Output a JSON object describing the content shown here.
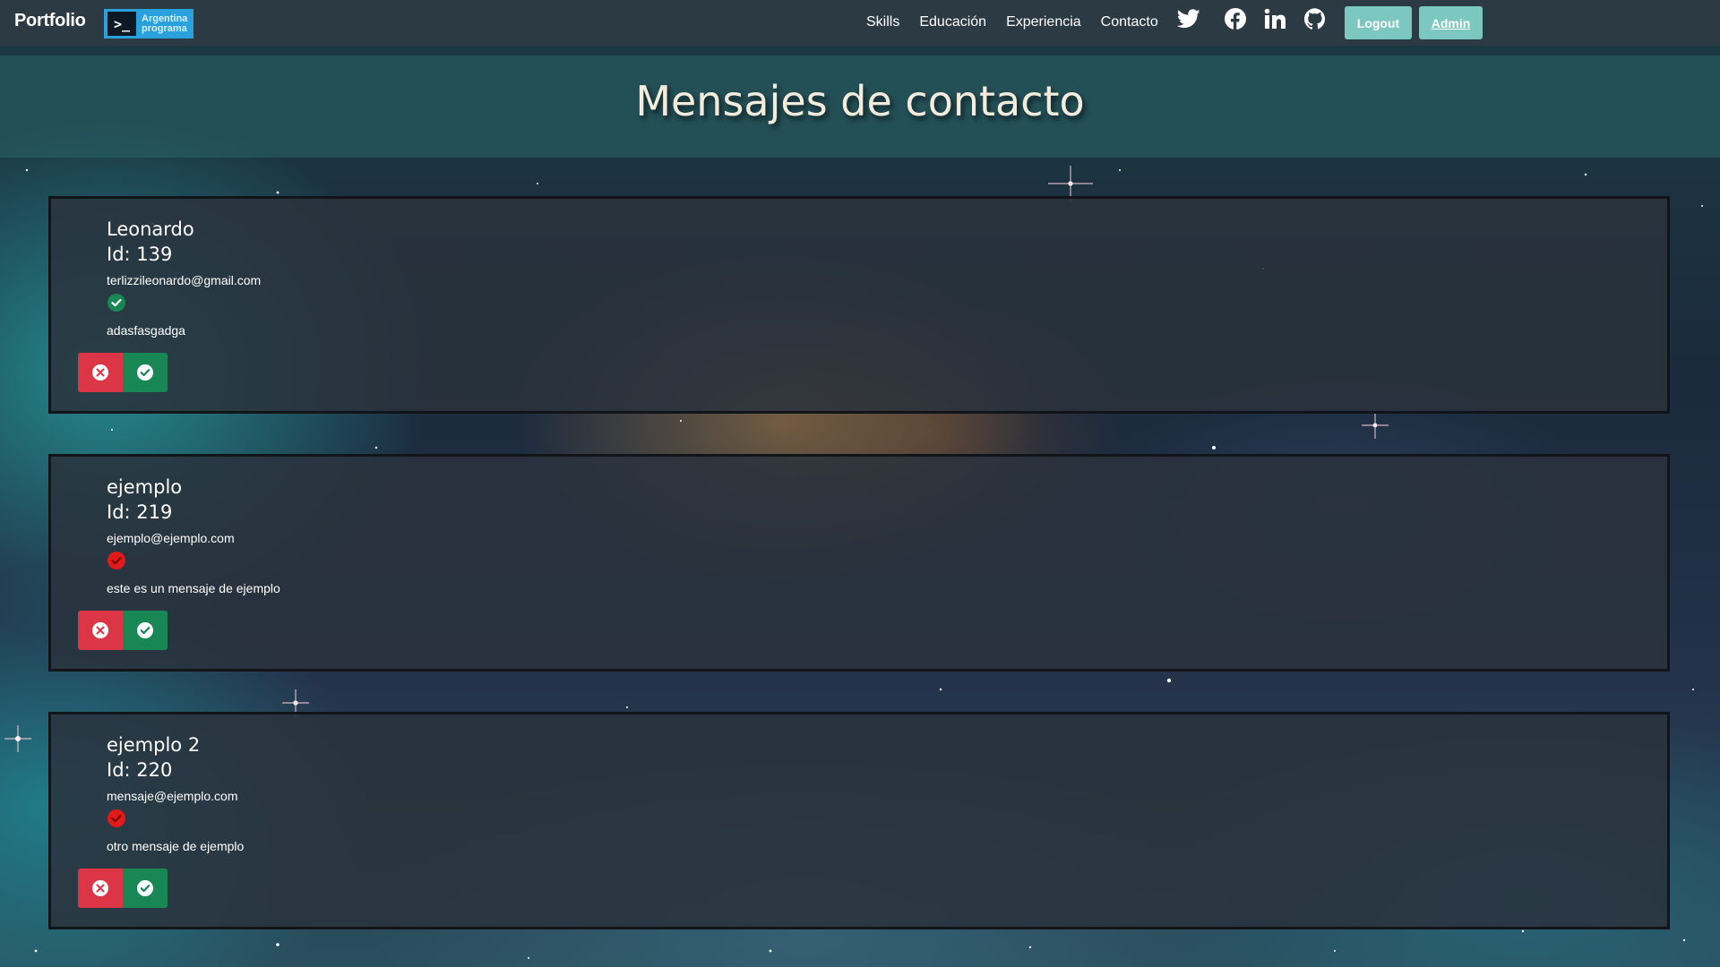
{
  "navbar": {
    "brand": "Portfolio",
    "logo_line1": "Argentina",
    "logo_line2": "programa",
    "logo_prompt": ">_",
    "links": [
      "Skills",
      "Educación",
      "Experiencia",
      "Contacto"
    ],
    "social_icons": [
      "twitter-icon",
      "facebook-icon",
      "linkedin-icon",
      "github-icon"
    ],
    "logout_label": "Logout",
    "admin_label": "Admin"
  },
  "page": {
    "title": "Mensajes de contacto"
  },
  "messages": [
    {
      "name": "Leonardo",
      "id_label": "Id: 139",
      "email": "terlizzileonardo@gmail.com",
      "read": true,
      "message": "adasfasgadga"
    },
    {
      "name": "ejemplo",
      "id_label": "Id: 219",
      "email": "ejemplo@ejemplo.com",
      "read": false,
      "message": "este es un mensaje de ejemplo"
    },
    {
      "name": "ejemplo 2",
      "id_label": "Id: 220",
      "email": "mensaje@ejemplo.com",
      "read": false,
      "message": "otro mensaje de ejemplo"
    }
  ],
  "colors": {
    "navbar_bg": "#2c3a44",
    "nav_button": "#7cc7c0",
    "delete_button": "#dc3545",
    "confirm_button": "#198754",
    "status_read": "#198754",
    "status_unread": "#e11a1a",
    "logo_bg": "#2aa0dc"
  }
}
